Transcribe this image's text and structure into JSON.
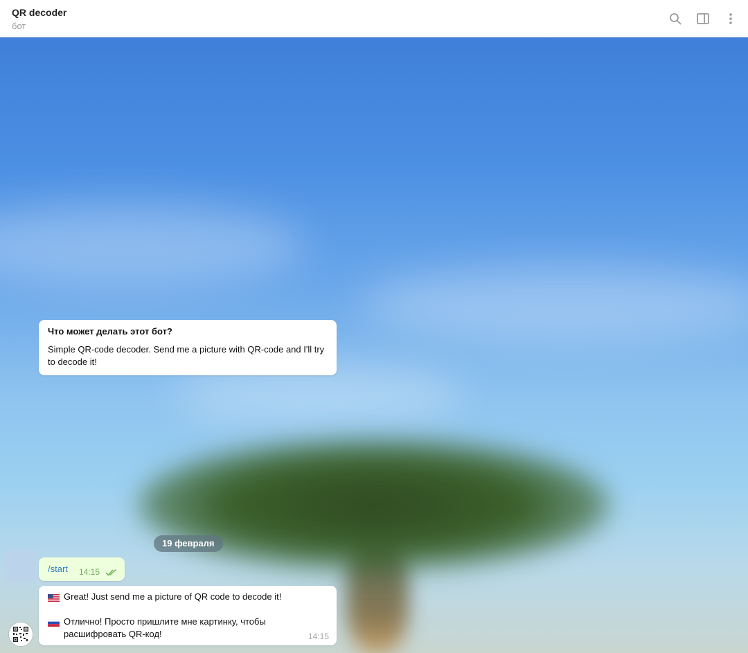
{
  "header": {
    "title": "QR decoder",
    "subtitle": "бот",
    "icons": [
      "search-icon",
      "sidebar-toggle-icon",
      "more-vertical-icon"
    ]
  },
  "intro_card": {
    "title": "Что может делать этот бот?",
    "text": "Simple QR-code decoder. Send me a picture with QR-code and I'll try to decode it!"
  },
  "date_separator": "19 февраля",
  "messages": [
    {
      "direction": "outgoing",
      "text": "/start",
      "time": "14:15",
      "status": "read"
    },
    {
      "direction": "incoming",
      "lines": [
        {
          "flag": "us-flag-icon",
          "text": "Great! Just send me a picture of QR code to decode it!"
        },
        {
          "flag": "ru-flag-icon",
          "text": "Отлично! Просто пришлите мне картинку, чтобы расшифровать QR-код!"
        }
      ],
      "time": "14:15"
    }
  ],
  "colors": {
    "outgoing_bubble": "#eeffde",
    "incoming_bubble": "#ffffff",
    "link": "#2f7fc1",
    "read_ticks": "#6fb05a"
  }
}
